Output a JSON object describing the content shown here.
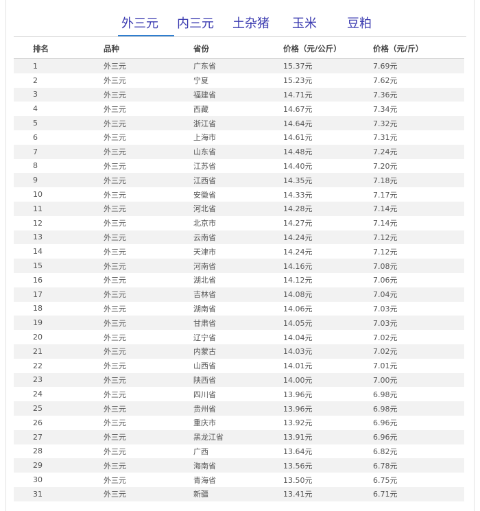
{
  "tabs": [
    {
      "label": "外三元",
      "active": true
    },
    {
      "label": "内三元",
      "active": false
    },
    {
      "label": "土杂猪",
      "active": false
    },
    {
      "label": "玉米",
      "active": false
    },
    {
      "label": "豆粕",
      "active": false
    }
  ],
  "table": {
    "headers": [
      "排名",
      "品种",
      "省份",
      "价格（元/公斤）",
      "价格（元/斤）"
    ],
    "rows": [
      [
        "1",
        "外三元",
        "广东省",
        "15.37元",
        "7.69元"
      ],
      [
        "2",
        "外三元",
        "宁夏",
        "15.23元",
        "7.62元"
      ],
      [
        "3",
        "外三元",
        "福建省",
        "14.71元",
        "7.36元"
      ],
      [
        "4",
        "外三元",
        "西藏",
        "14.67元",
        "7.34元"
      ],
      [
        "5",
        "外三元",
        "浙江省",
        "14.64元",
        "7.32元"
      ],
      [
        "6",
        "外三元",
        "上海市",
        "14.61元",
        "7.31元"
      ],
      [
        "7",
        "外三元",
        "山东省",
        "14.48元",
        "7.24元"
      ],
      [
        "8",
        "外三元",
        "江苏省",
        "14.40元",
        "7.20元"
      ],
      [
        "9",
        "外三元",
        "江西省",
        "14.35元",
        "7.18元"
      ],
      [
        "10",
        "外三元",
        "安徽省",
        "14.33元",
        "7.17元"
      ],
      [
        "11",
        "外三元",
        "河北省",
        "14.28元",
        "7.14元"
      ],
      [
        "12",
        "外三元",
        "北京市",
        "14.27元",
        "7.14元"
      ],
      [
        "13",
        "外三元",
        "云南省",
        "14.24元",
        "7.12元"
      ],
      [
        "14",
        "外三元",
        "天津市",
        "14.24元",
        "7.12元"
      ],
      [
        "15",
        "外三元",
        "河南省",
        "14.16元",
        "7.08元"
      ],
      [
        "16",
        "外三元",
        "湖北省",
        "14.12元",
        "7.06元"
      ],
      [
        "17",
        "外三元",
        "吉林省",
        "14.08元",
        "7.04元"
      ],
      [
        "18",
        "外三元",
        "湖南省",
        "14.06元",
        "7.03元"
      ],
      [
        "19",
        "外三元",
        "甘肃省",
        "14.05元",
        "7.03元"
      ],
      [
        "20",
        "外三元",
        "辽宁省",
        "14.04元",
        "7.02元"
      ],
      [
        "21",
        "外三元",
        "内蒙古",
        "14.03元",
        "7.02元"
      ],
      [
        "22",
        "外三元",
        "山西省",
        "14.01元",
        "7.01元"
      ],
      [
        "23",
        "外三元",
        "陕西省",
        "14.00元",
        "7.00元"
      ],
      [
        "24",
        "外三元",
        "四川省",
        "13.96元",
        "6.98元"
      ],
      [
        "25",
        "外三元",
        "贵州省",
        "13.96元",
        "6.98元"
      ],
      [
        "26",
        "外三元",
        "重庆市",
        "13.92元",
        "6.96元"
      ],
      [
        "27",
        "外三元",
        "黑龙江省",
        "13.91元",
        "6.96元"
      ],
      [
        "28",
        "外三元",
        "广西",
        "13.64元",
        "6.82元"
      ],
      [
        "29",
        "外三元",
        "海南省",
        "13.56元",
        "6.78元"
      ],
      [
        "30",
        "外三元",
        "青海省",
        "13.50元",
        "6.75元"
      ],
      [
        "31",
        "外三元",
        "新疆",
        "13.41元",
        "6.71元"
      ]
    ]
  }
}
